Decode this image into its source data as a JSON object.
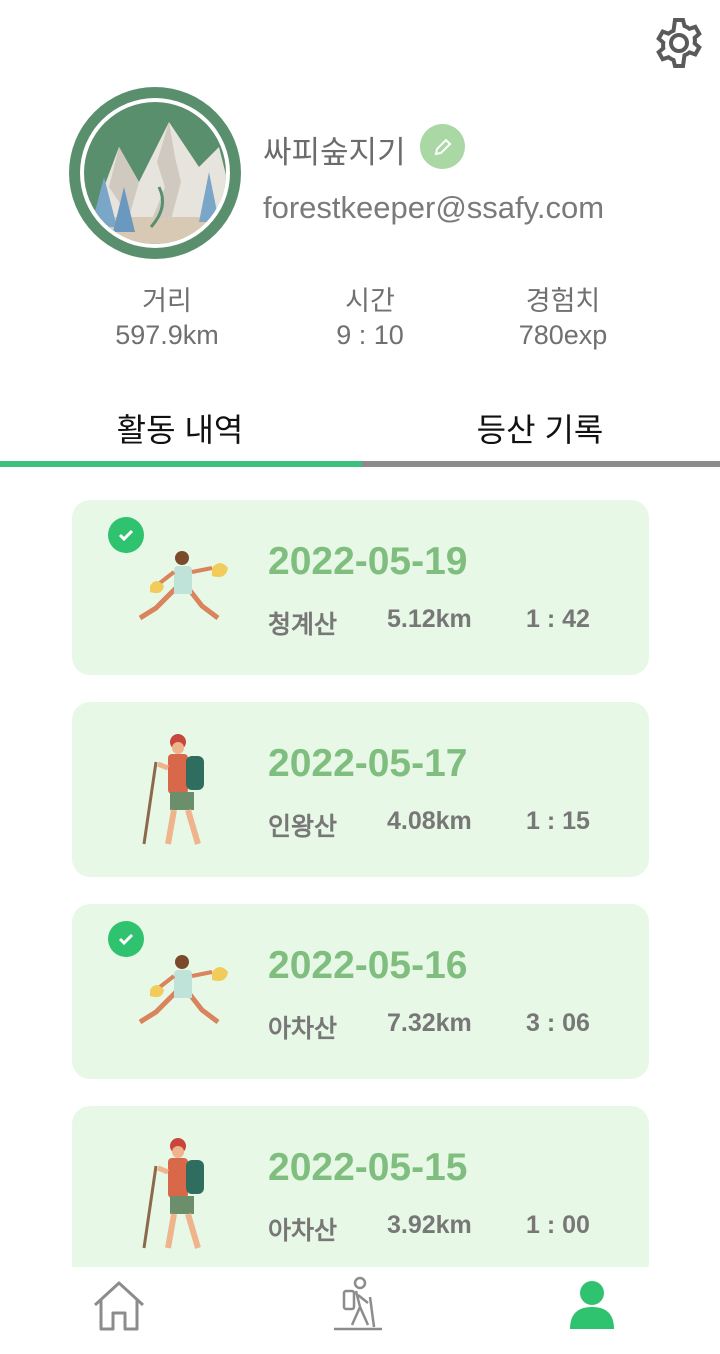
{
  "profile": {
    "nickname": "싸피숲지기",
    "email": "forestkeeper@ssafy.com"
  },
  "stats": [
    {
      "label": "거리",
      "value": "597.9km"
    },
    {
      "label": "시간",
      "value": "9 : 10"
    },
    {
      "label": "경험치",
      "value": "780exp"
    }
  ],
  "tabs": [
    {
      "label": "활동 내역",
      "active": true
    },
    {
      "label": "등산 기록",
      "active": false
    }
  ],
  "colors": {
    "accent": "#3ec07f",
    "card_bg": "#e8f8e6",
    "date_text": "#7fbe7f",
    "edit_button": "#a9d8a4"
  },
  "records": [
    {
      "date": "2022-05-19",
      "mountain": "청계산",
      "distance": "5.12km",
      "duration": "1 : 42",
      "checked": true,
      "icon": "plogging-runner-icon"
    },
    {
      "date": "2022-05-17",
      "mountain": "인왕산",
      "distance": "4.08km",
      "duration": "1 : 15",
      "checked": false,
      "icon": "hiker-icon"
    },
    {
      "date": "2022-05-16",
      "mountain": "아차산",
      "distance": "7.32km",
      "duration": "3 : 06",
      "checked": true,
      "icon": "plogging-runner-icon"
    },
    {
      "date": "2022-05-15",
      "mountain": "아차산",
      "distance": "3.92km",
      "duration": "1 : 00",
      "checked": false,
      "icon": "hiker-icon"
    }
  ],
  "nav": [
    {
      "icon": "home-icon",
      "active": false
    },
    {
      "icon": "hiking-icon",
      "active": false
    },
    {
      "icon": "profile-icon",
      "active": true
    }
  ]
}
